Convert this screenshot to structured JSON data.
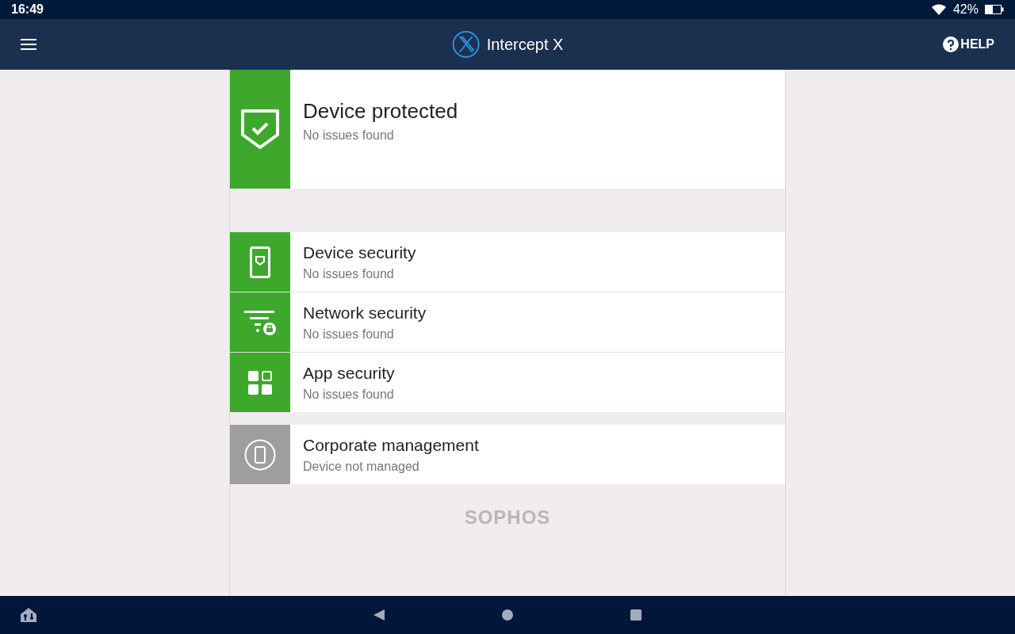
{
  "status_bar": {
    "time": "16:49",
    "battery": "42%"
  },
  "app_bar": {
    "title": "Intercept X",
    "help": "HELP"
  },
  "hero": {
    "kind": "shield",
    "color": "#3ea82c",
    "title": "Device protected",
    "subtitle": "No issues found"
  },
  "groups": [
    {
      "items": [
        {
          "kind": "tablet",
          "color": "#3ea82c",
          "title": "Device security",
          "subtitle": "No issues found"
        },
        {
          "kind": "filter",
          "color": "#3ea82c",
          "title": "Network security",
          "subtitle": "No issues found"
        },
        {
          "kind": "apps",
          "color": "#3ea82c",
          "title": "App security",
          "subtitle": "No issues found"
        }
      ]
    },
    {
      "items": [
        {
          "kind": "phone",
          "color": "#9e9e9e",
          "title": "Corporate management",
          "subtitle": "Device not managed"
        }
      ]
    }
  ],
  "brand": "SOPHOS"
}
